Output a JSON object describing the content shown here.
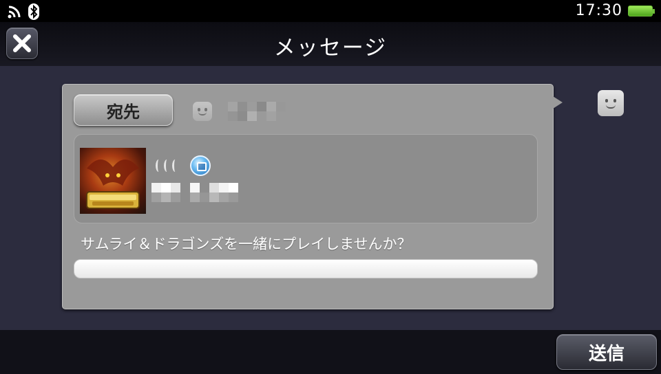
{
  "status_bar": {
    "time": "17:30",
    "icons": [
      "wifi-icon",
      "bluetooth-icon",
      "battery-icon"
    ],
    "battery_color": "#6fbf3a"
  },
  "header": {
    "title": "メッセージ",
    "close_icon": "close-icon"
  },
  "panel": {
    "recipient_button_label": "宛先",
    "recipient_avatar_icon": "avatar-face-icon",
    "invite": {
      "game_icon": "samurai-dragons-game-icon",
      "signal_icon": "signal-waves-icon",
      "app_badge_icon": "party-app-icon"
    },
    "message_text": "サムライ＆ドラゴンズを一緒にプレイしませんか？",
    "input_value": ""
  },
  "my_avatar_icon": "avatar-face-icon",
  "footer": {
    "send_label": "送信"
  },
  "colors": {
    "background": "#2c2c3e",
    "panel": "#9a9a9a",
    "header": "#0c0c12"
  }
}
